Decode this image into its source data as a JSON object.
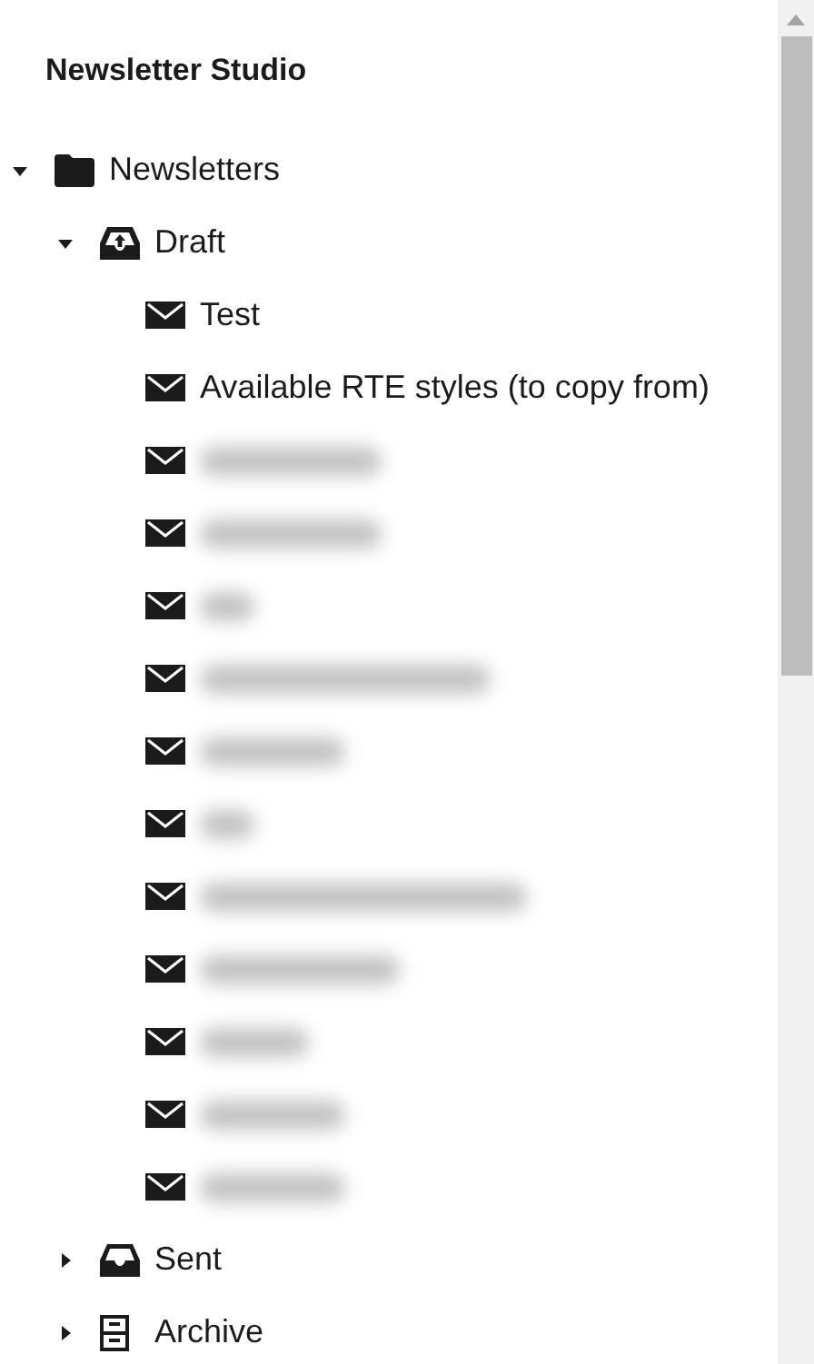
{
  "panel": {
    "title": "Newsletter Studio"
  },
  "tree": [
    {
      "kind": "folder",
      "label": "Newsletters",
      "expanded": true,
      "children": [
        {
          "kind": "draft",
          "label": "Draft",
          "expanded": true,
          "children": [
            {
              "kind": "mail",
              "label": "Test"
            },
            {
              "kind": "mail",
              "label": "Available RTE styles (to copy from)"
            },
            {
              "kind": "mail",
              "redacted": true
            },
            {
              "kind": "mail",
              "redacted": true
            },
            {
              "kind": "mail",
              "redacted": true
            },
            {
              "kind": "mail",
              "redacted": true
            },
            {
              "kind": "mail",
              "redacted": true
            },
            {
              "kind": "mail",
              "redacted": true
            },
            {
              "kind": "mail",
              "redacted": true
            },
            {
              "kind": "mail",
              "redacted": true
            },
            {
              "kind": "mail",
              "redacted": true
            },
            {
              "kind": "mail",
              "redacted": true
            },
            {
              "kind": "mail",
              "redacted": true
            }
          ]
        },
        {
          "kind": "sent",
          "label": "Sent",
          "expanded": false
        },
        {
          "kind": "archive",
          "label": "Archive",
          "expanded": false
        }
      ]
    }
  ]
}
